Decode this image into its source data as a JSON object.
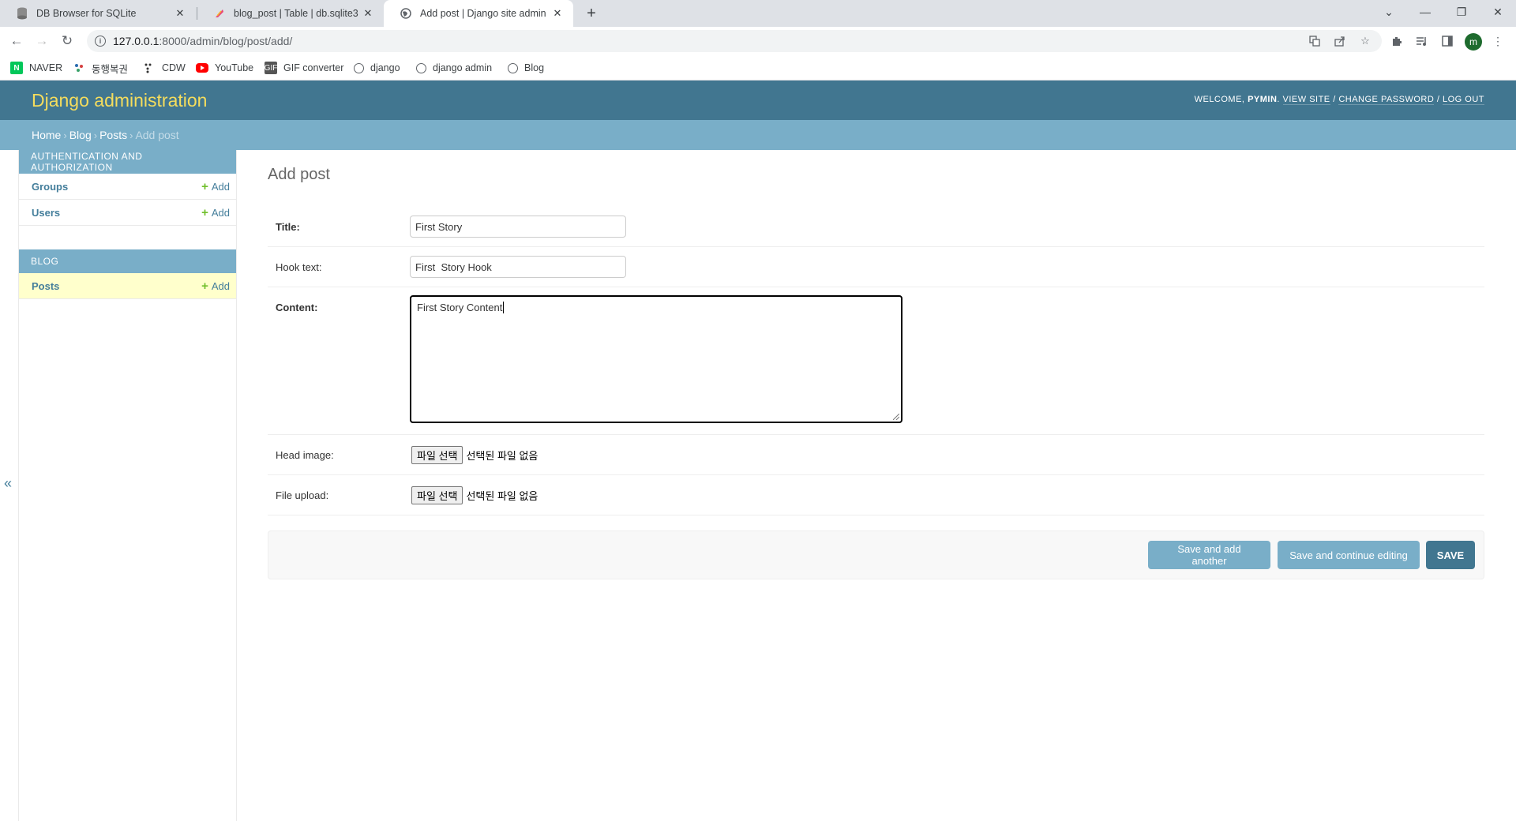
{
  "browser": {
    "tabs": [
      {
        "title": "DB Browser for SQLite",
        "icon": "database-icon",
        "active": false
      },
      {
        "title": "blog_post | Table | db.sqlite3",
        "icon": "feather-icon",
        "active": false
      },
      {
        "title": "Add post | Django site admin",
        "icon": "globe-icon",
        "active": true
      }
    ],
    "url_host": "127.0.0.1",
    "url_path": ":8000/admin/blog/post/add/",
    "profile_initial": "m",
    "bookmarks": [
      {
        "label": "NAVER",
        "icon": "naver-icon"
      },
      {
        "label": "동행복권",
        "icon": "lottery-icon"
      },
      {
        "label": "CDW",
        "icon": "dots-icon"
      },
      {
        "label": "YouTube",
        "icon": "youtube-icon"
      },
      {
        "label": "GIF converter",
        "icon": "gif-icon"
      },
      {
        "label": "django",
        "icon": "globe-icon"
      },
      {
        "label": "django admin",
        "icon": "globe-icon"
      },
      {
        "label": "Blog",
        "icon": "globe-icon"
      }
    ]
  },
  "header": {
    "branding": "Django administration",
    "welcome": "Welcome,",
    "username": "pymin",
    "view_site": "View site",
    "change_password": "Change password",
    "log_out": "Log out"
  },
  "breadcrumbs": {
    "home": "Home",
    "app": "Blog",
    "model": "Posts",
    "current": "Add post"
  },
  "sidebar": {
    "modules": [
      {
        "caption": "Authentication and Authorization",
        "models": [
          {
            "name": "Groups",
            "add": "Add"
          },
          {
            "name": "Users",
            "add": "Add"
          }
        ]
      },
      {
        "caption": "Blog",
        "models": [
          {
            "name": "Posts",
            "add": "Add",
            "current": true
          }
        ]
      }
    ],
    "collapse_toggle": "«"
  },
  "form": {
    "title": "Add post",
    "fields": {
      "title": {
        "label": "Title:",
        "value": "First Story"
      },
      "hook_text": {
        "label": "Hook text:",
        "value": "First  Story Hook"
      },
      "content": {
        "label": "Content:",
        "value": "First Story Content"
      },
      "head_image": {
        "label": "Head image:",
        "button": "파일 선택",
        "status": "선택된 파일 없음"
      },
      "file_upload": {
        "label": "File upload:",
        "button": "파일 선택",
        "status": "선택된 파일 없음"
      }
    },
    "buttons": {
      "save_add_another": "Save and add another",
      "save_continue": "Save and continue editing",
      "save": "Save"
    }
  },
  "colors": {
    "header_bg": "#417690",
    "branding": "#f5dd5d",
    "breadcrumbs_bg": "#79aec8",
    "link": "#447e9b",
    "add_plus": "#70bf2b",
    "current_row": "#ffffcc"
  }
}
